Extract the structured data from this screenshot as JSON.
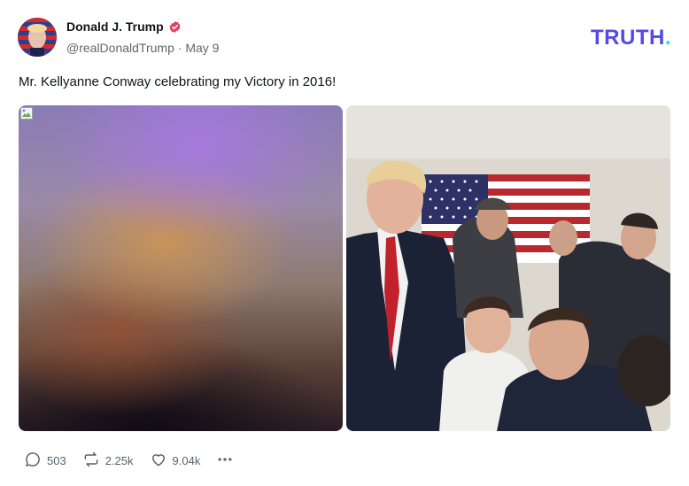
{
  "post": {
    "author": {
      "display_name": "Donald J. Trump",
      "handle": "@realDonaldTrump",
      "separator": "·",
      "date": "May 9",
      "verified": true
    },
    "brand": {
      "text": "TRUTH",
      "dot": "."
    },
    "text": "Mr. Kellyanne Conway celebrating my Victory in 2016!",
    "actions": {
      "replies": "503",
      "retruths": "2.25k",
      "likes": "9.04k"
    }
  },
  "colors": {
    "brand": "#5448ee",
    "brand_dot": "#17e3c6",
    "verified": "#e0405e",
    "muted_text": "#606770"
  },
  "icons": [
    "verified-badge-icon",
    "broken-image-icon",
    "reply-icon",
    "retruth-icon",
    "like-icon",
    "more-icon"
  ]
}
